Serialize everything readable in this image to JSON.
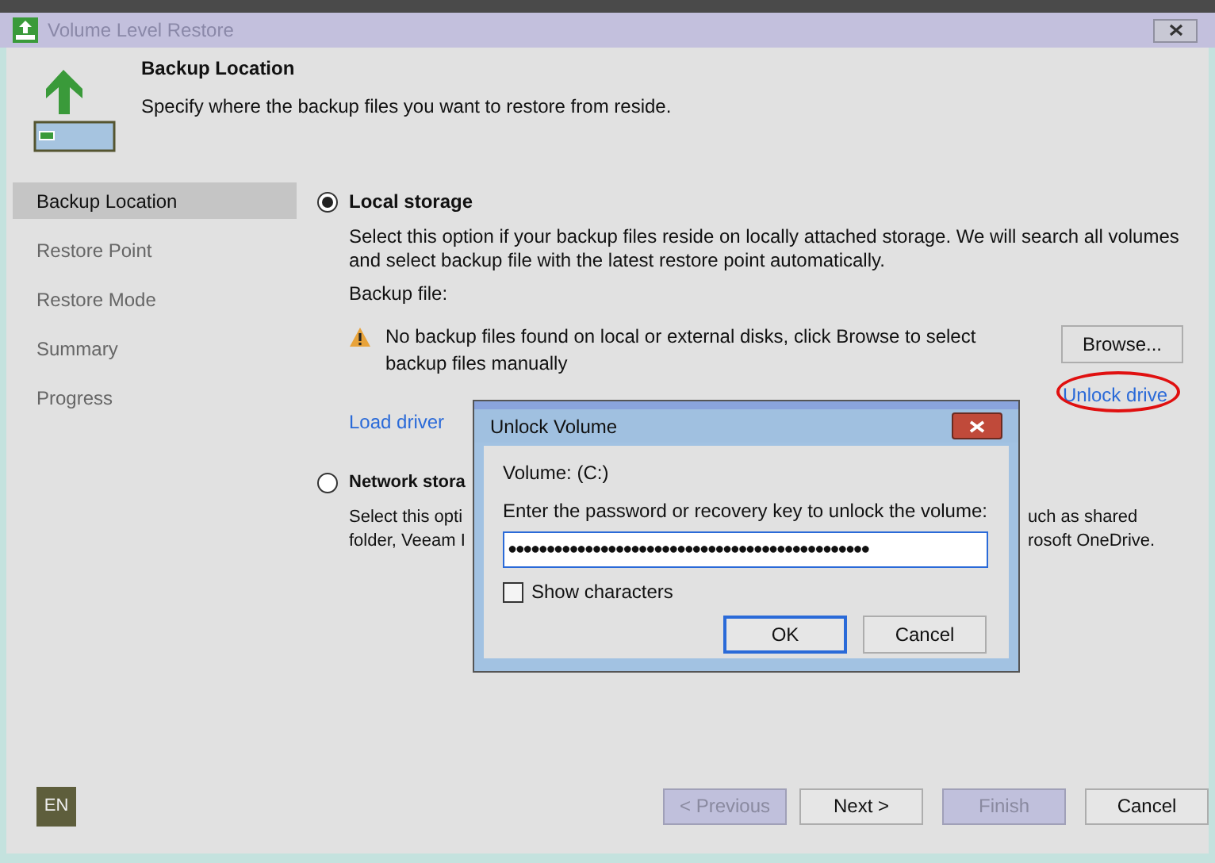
{
  "window": {
    "title": "Volume Level Restore"
  },
  "header": {
    "title": "Backup Location",
    "subtitle": "Specify where the backup files you want to restore from reside."
  },
  "sidebar": {
    "items": [
      {
        "label": "Backup Location",
        "selected": true
      },
      {
        "label": "Restore Point",
        "selected": false
      },
      {
        "label": "Restore Mode",
        "selected": false
      },
      {
        "label": "Summary",
        "selected": false
      },
      {
        "label": "Progress",
        "selected": false
      }
    ]
  },
  "local_storage": {
    "label": "Local storage",
    "selected": true,
    "description": "Select this option if your backup files reside on locally attached storage. We will search all volumes and select backup file with the latest restore point automatically.",
    "backup_file_label": "Backup file:",
    "warning": "No backup files found on local or external disks, click Browse to select backup files manually",
    "browse_button": "Browse...",
    "load_driver_link": "Load driver",
    "unlock_drive_link": "Unlock drive"
  },
  "network_storage": {
    "label": "Network stora",
    "selected": false,
    "description_lines": [
      [
        "Select this opti",
        "uch as shared"
      ],
      [
        "folder, Veeam I",
        "rosoft OneDrive."
      ]
    ]
  },
  "language_badge": "EN",
  "buttons": [
    {
      "label": "< Previous",
      "disabled": true
    },
    {
      "label": "Next >",
      "disabled": false
    },
    {
      "label": "Finish",
      "disabled": true
    },
    {
      "label": "Cancel",
      "disabled": false
    }
  ],
  "dialog": {
    "title": "Unlock Volume",
    "volume": "Volume: (C:)",
    "prompt": "Enter the password or recovery key to unlock the volume:",
    "password": "●●●●●●●●●●●●●●●●●●●●●●●●●●●●●●●●●●●●●●●●●●●●●●●",
    "show_characters": {
      "label": "Show characters",
      "checked": false
    },
    "ok_button": "OK",
    "cancel_button": "Cancel"
  }
}
